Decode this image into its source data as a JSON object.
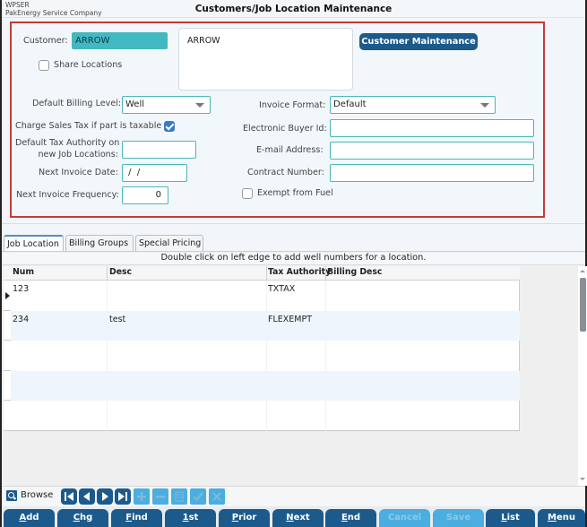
{
  "header": {
    "system_code": "WPSER",
    "company": "PakEnergy Service Company",
    "title": "Customers/Job Location Maintenance"
  },
  "form": {
    "customer_label": "Customer:",
    "customer_value": "ARROW",
    "customer_name_display": "ARROW",
    "customer_maintenance_button": "Customer Maintenance",
    "share_locations_label": "Share Locations",
    "share_locations_checked": false,
    "default_billing_level_label": "Default Billing Level:",
    "default_billing_level_value": "Well",
    "charge_sales_tax_label": "Charge Sales Tax if part is taxable",
    "charge_sales_tax_checked": true,
    "default_tax_authority_label_line1": "Default Tax Authority on",
    "default_tax_authority_label_line2": "new Job Locations:",
    "default_tax_authority_value": "",
    "next_invoice_date_label": "Next Invoice Date:",
    "next_invoice_date_value": " /  /",
    "next_invoice_frequency_label": "Next Invoice Frequency:",
    "next_invoice_frequency_value": "0",
    "invoice_format_label": "Invoice Format:",
    "invoice_format_value": "Default",
    "electronic_buyer_id_label": "Electronic Buyer Id:",
    "electronic_buyer_id_value": "",
    "email_address_label": "E-mail Address:",
    "email_address_value": "",
    "contract_number_label": "Contract Number:",
    "contract_number_value": "",
    "exempt_from_fuel_label": "Exempt from Fuel",
    "exempt_from_fuel_checked": false
  },
  "tabs": [
    {
      "label": "Job Location",
      "active": true
    },
    {
      "label": "Billing Groups",
      "active": false
    },
    {
      "label": "Special Pricing",
      "active": false
    }
  ],
  "grid": {
    "hint": "Double click on left edge to add well numbers for a location.",
    "columns": [
      "Num",
      "Desc",
      "Tax Authority",
      "Billing Desc"
    ],
    "rows": [
      {
        "num": "123",
        "desc": "",
        "tax_authority": "TXTAX",
        "billing_desc": "",
        "current": true
      },
      {
        "num": "234",
        "desc": "test",
        "tax_authority": "FLEXEMPT",
        "billing_desc": "",
        "current": false
      },
      {
        "num": "",
        "desc": "",
        "tax_authority": "",
        "billing_desc": "",
        "current": false
      },
      {
        "num": "",
        "desc": "",
        "tax_authority": "",
        "billing_desc": "",
        "current": false
      },
      {
        "num": "",
        "desc": "",
        "tax_authority": "",
        "billing_desc": "",
        "current": false
      }
    ]
  },
  "navigator": {
    "mode_label": "Browse",
    "buttons": [
      {
        "icon": "first-record-icon",
        "enabled": true
      },
      {
        "icon": "prior-record-icon",
        "enabled": true
      },
      {
        "icon": "next-record-icon",
        "enabled": true
      },
      {
        "icon": "last-record-icon",
        "enabled": true
      },
      {
        "icon": "plus-icon",
        "enabled": false
      },
      {
        "icon": "minus-icon",
        "enabled": false
      },
      {
        "icon": "edit-grid-icon",
        "enabled": false
      },
      {
        "icon": "checkmark-icon",
        "enabled": false
      },
      {
        "icon": "cancel-x-icon",
        "enabled": false
      }
    ]
  },
  "commands": [
    {
      "label": "Add",
      "hotkey": "A",
      "rest": "dd",
      "enabled": true
    },
    {
      "label": "Chg",
      "hotkey": "C",
      "rest": "hg",
      "enabled": true
    },
    {
      "label": "Find",
      "hotkey": "F",
      "rest": "ind",
      "enabled": true
    },
    {
      "label": "1st",
      "hotkey": "1",
      "rest": "st",
      "enabled": true
    },
    {
      "label": "Prior",
      "hotkey": "P",
      "rest": "rior",
      "enabled": true
    },
    {
      "label": "Next",
      "hotkey": "N",
      "rest": "ext",
      "enabled": true
    },
    {
      "label": "End",
      "hotkey": "E",
      "rest": "nd",
      "enabled": true
    },
    {
      "label": "Cancel",
      "hotkey": "",
      "rest": "Cancel",
      "enabled": false
    },
    {
      "label": "Save",
      "hotkey": "",
      "rest": "Save",
      "enabled": false
    },
    {
      "label": "List",
      "hotkey": "L",
      "rest": "ist",
      "enabled": true
    },
    {
      "label": "Menu",
      "hotkey": "M",
      "rest": "enu",
      "enabled": true
    }
  ]
}
